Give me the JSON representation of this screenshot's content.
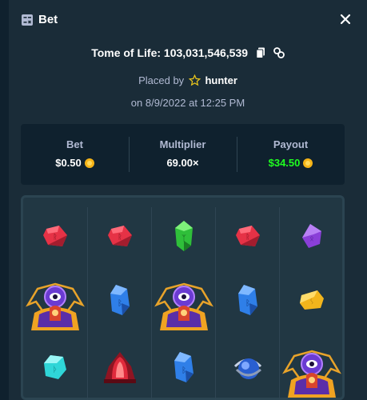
{
  "header": {
    "title": "Bet",
    "icon": "bet-slip-icon",
    "close_icon": "close-icon"
  },
  "game": {
    "name_line": "Tome of Life: 103,031,546,539",
    "copy_icon": "copy-icon",
    "link_icon": "link-icon"
  },
  "placed": {
    "prefix": "Placed by",
    "user": "hunter",
    "badge_icon": "star-icon"
  },
  "date": "on 8/9/2022 at 12:25 PM",
  "stats": {
    "bet_label": "Bet",
    "bet_value": "$0.50",
    "multiplier_label": "Multiplier",
    "multiplier_value": "69.00×",
    "payout_label": "Payout",
    "payout_value": "$34.50"
  },
  "colors": {
    "background": "#1a2c38",
    "panel": "#0f212e",
    "payout": "#1fff20",
    "coin": "#f6b417"
  },
  "board": {
    "reels": [
      [
        "red-gem",
        "tome-of-life",
        "cyan-gem"
      ],
      [
        "red-gem",
        "blue-gem",
        "red-portal"
      ],
      [
        "green-gem",
        "tome-of-life",
        "blue-gem"
      ],
      [
        "red-gem",
        "blue-gem",
        "blue-orb"
      ],
      [
        "purple-gem",
        "yellow-gem",
        "tome-of-life"
      ]
    ]
  }
}
